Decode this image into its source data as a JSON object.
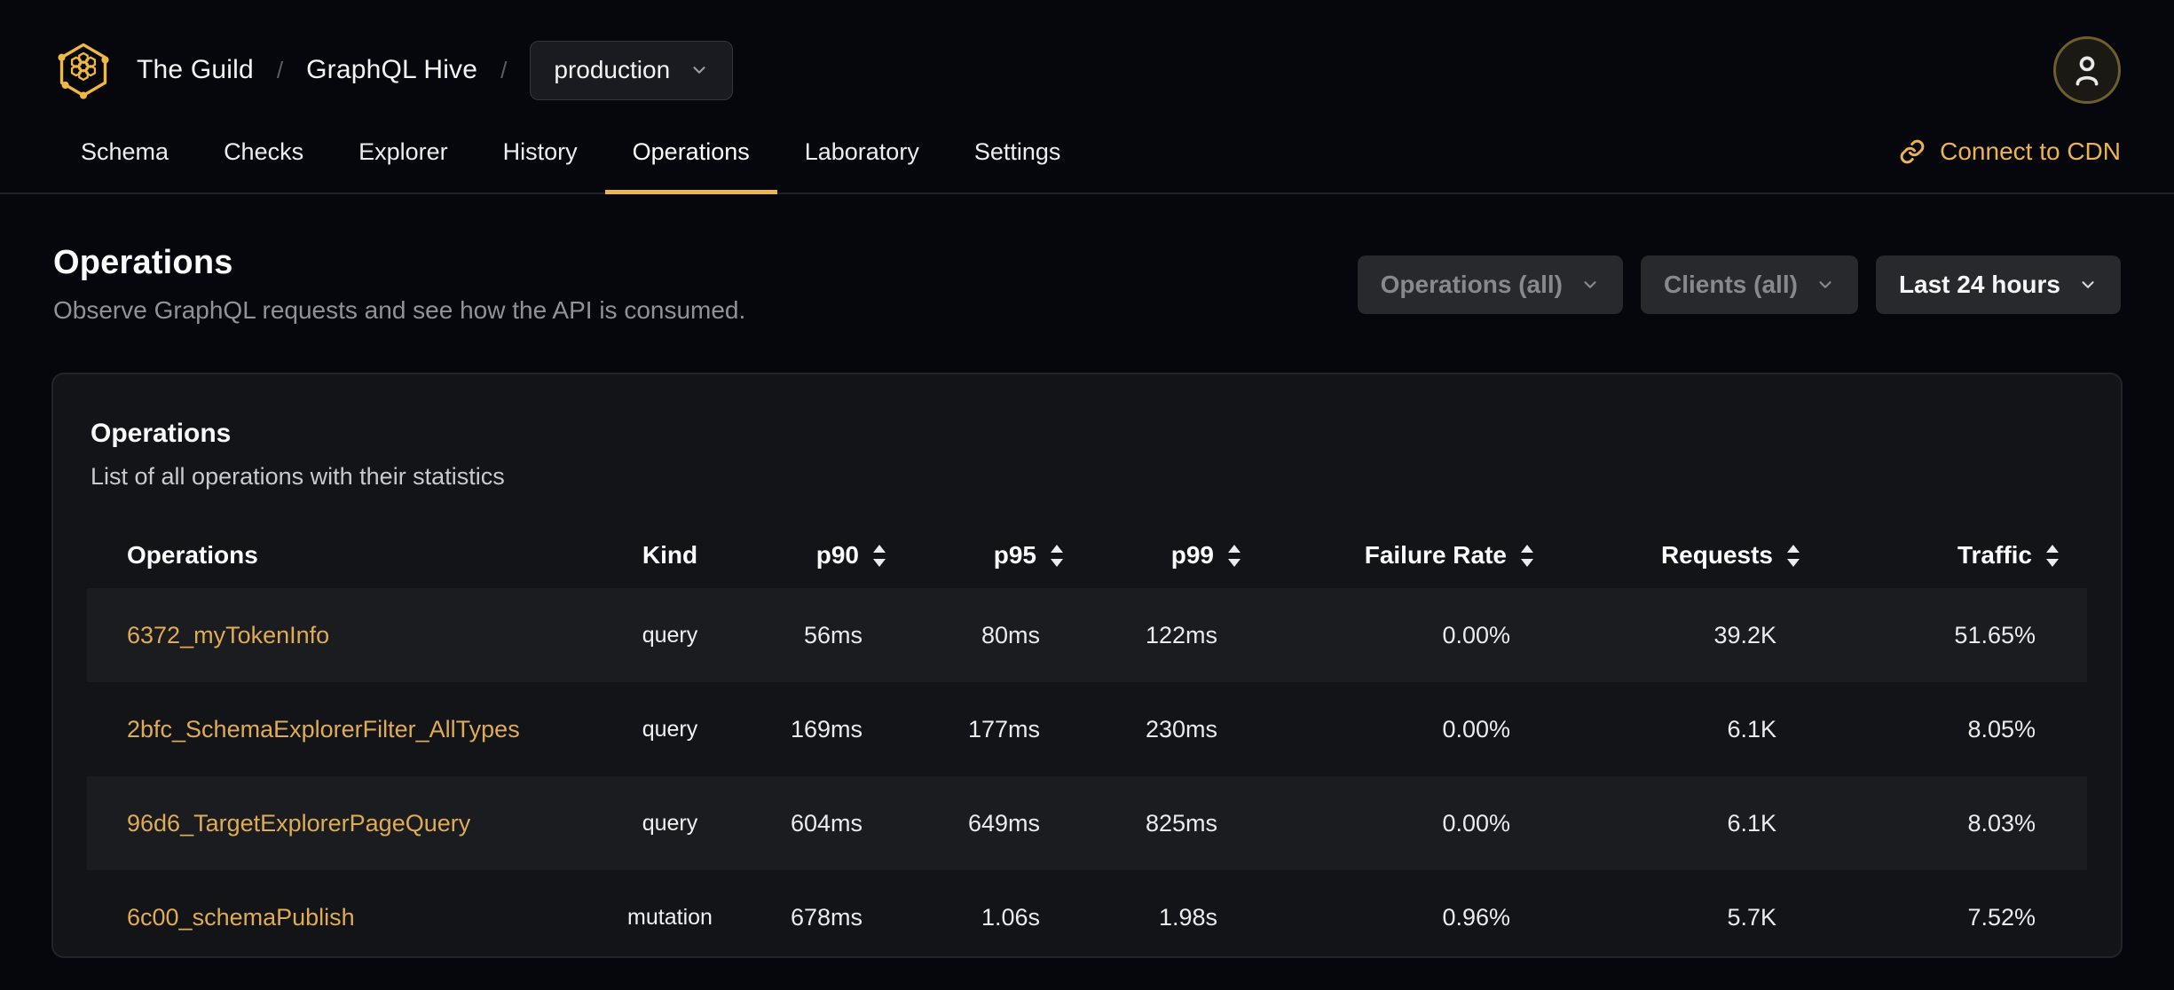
{
  "colors": {
    "page_bg": "#05070d",
    "card_bg": "#131417",
    "stripe_bg": "#1b1c20",
    "accent_gold": "#eab455",
    "link_gold": "#dfab55"
  },
  "breadcrumb": {
    "logo": "guild-hive-logo",
    "org": "The Guild",
    "separator": "/",
    "project": "GraphQL Hive",
    "target_selector": {
      "value": "production",
      "icon": "chevron-down-icon"
    }
  },
  "account": {
    "avatar_icon": "user-icon"
  },
  "nav": {
    "tabs": [
      {
        "label": "Schema",
        "active": false
      },
      {
        "label": "Checks",
        "active": false
      },
      {
        "label": "Explorer",
        "active": false
      },
      {
        "label": "History",
        "active": false
      },
      {
        "label": "Operations",
        "active": true
      },
      {
        "label": "Laboratory",
        "active": false
      },
      {
        "label": "Settings",
        "active": false
      }
    ],
    "cdn_link": {
      "label": "Connect to CDN",
      "icon": "link-icon"
    }
  },
  "page": {
    "title": "Operations",
    "subtitle": "Observe GraphQL requests and see how the API is consumed."
  },
  "filters": {
    "operations": {
      "label": "Operations (all)",
      "enabled": false
    },
    "clients": {
      "label": "Clients (all)",
      "enabled": false
    },
    "period": {
      "label": "Last 24 hours",
      "enabled": true
    }
  },
  "card": {
    "title": "Operations",
    "subtitle": "List of all operations with their statistics"
  },
  "table": {
    "columns": [
      {
        "key": "name",
        "label": "Operations",
        "sortable": false,
        "align": "left"
      },
      {
        "key": "kind",
        "label": "Kind",
        "sortable": false,
        "align": "center"
      },
      {
        "key": "p90",
        "label": "p90",
        "sortable": true,
        "align": "right"
      },
      {
        "key": "p95",
        "label": "p95",
        "sortable": true,
        "align": "right"
      },
      {
        "key": "p99",
        "label": "p99",
        "sortable": true,
        "align": "right"
      },
      {
        "key": "failure_rate",
        "label": "Failure Rate",
        "sortable": true,
        "align": "right"
      },
      {
        "key": "requests",
        "label": "Requests",
        "sortable": true,
        "align": "right"
      },
      {
        "key": "traffic",
        "label": "Traffic",
        "sortable": true,
        "align": "right"
      }
    ],
    "rows": [
      {
        "name": "6372_myTokenInfo",
        "kind": "query",
        "p90": "56ms",
        "p95": "80ms",
        "p99": "122ms",
        "failure_rate": "0.00%",
        "requests": "39.2K",
        "traffic": "51.65%"
      },
      {
        "name": "2bfc_SchemaExplorerFilter_AllTypes",
        "kind": "query",
        "p90": "169ms",
        "p95": "177ms",
        "p99": "230ms",
        "failure_rate": "0.00%",
        "requests": "6.1K",
        "traffic": "8.05%"
      },
      {
        "name": "96d6_TargetExplorerPageQuery",
        "kind": "query",
        "p90": "604ms",
        "p95": "649ms",
        "p99": "825ms",
        "failure_rate": "0.00%",
        "requests": "6.1K",
        "traffic": "8.03%"
      },
      {
        "name": "6c00_schemaPublish",
        "kind": "mutation",
        "p90": "678ms",
        "p95": "1.06s",
        "p99": "1.98s",
        "failure_rate": "0.96%",
        "requests": "5.7K",
        "traffic": "7.52%"
      }
    ]
  }
}
